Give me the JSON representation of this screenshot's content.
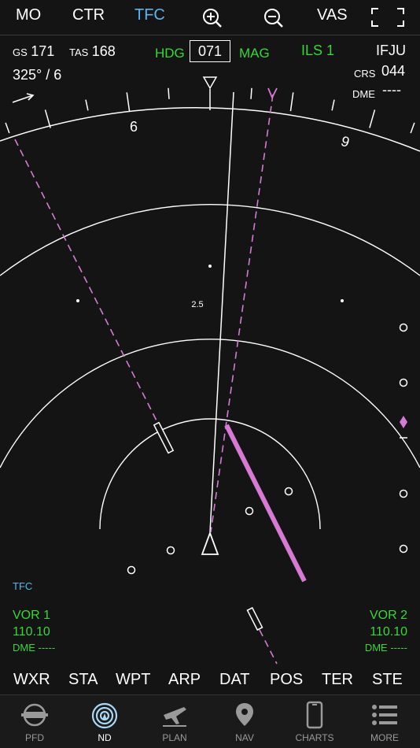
{
  "topbar": {
    "mode_mo": "MO",
    "mode_ctr": "CTR",
    "mode_tfc": "TFC",
    "zoom_in_icon": "zoom-in-icon",
    "zoom_out_icon": "zoom-out-icon",
    "vas": "VAS",
    "fullscreen_icon": "fullscreen-icon"
  },
  "status": {
    "gs_label": "GS",
    "gs_value": "171",
    "tas_label": "TAS",
    "tas_value": "168",
    "wind": "325° / 6",
    "hdg_label": "HDG",
    "hdg_value": "071",
    "mag_label": "MAG",
    "nav_source": "ILS 1",
    "ident": "IFJU",
    "crs_label": "CRS",
    "crs_value": "044",
    "dme_label": "DME",
    "dme_value": "----"
  },
  "compass": {
    "label_6": "6",
    "label_9": "9",
    "range_label": "2.5"
  },
  "bottom_info": {
    "tfc": "TFC",
    "vor1_label": "VOR 1",
    "vor1_freq": "110.10",
    "vor1_dme": "DME -----",
    "vor2_label": "VOR 2",
    "vor2_freq": "110.10",
    "vor2_dme": "DME -----"
  },
  "softkeys": [
    "WXR",
    "STA",
    "WPT",
    "ARP",
    "DAT",
    "POS",
    "TER",
    "STE"
  ],
  "tabs": [
    {
      "label": "PFD",
      "icon": "pfd-icon"
    },
    {
      "label": "ND",
      "icon": "nd-icon"
    },
    {
      "label": "PLAN",
      "icon": "plan-icon"
    },
    {
      "label": "NAV",
      "icon": "nav-pin-icon"
    },
    {
      "label": "CHARTS",
      "icon": "charts-icon"
    },
    {
      "label": "MORE",
      "icon": "more-icon"
    }
  ],
  "colors": {
    "accent_blue": "#5ab6f0",
    "green": "#36d836",
    "magenta": "#d77ad6",
    "background": "#141414"
  }
}
